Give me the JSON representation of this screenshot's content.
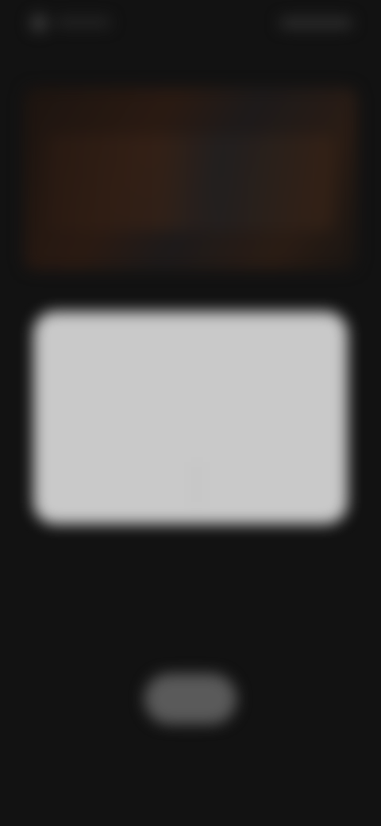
{
  "status_bar": {
    "left_icon": "app-icon",
    "left_text": "",
    "right_text": ""
  },
  "hero": {
    "description": ""
  },
  "dialog": {
    "title": "",
    "body": "",
    "buttons": [
      {
        "label": ""
      },
      {
        "label": ""
      }
    ]
  },
  "bottom_button": {
    "label": ""
  },
  "colors": {
    "background": "#121212",
    "dialog": "#c9c9c9",
    "bottom_button": "#5a5a5a"
  }
}
